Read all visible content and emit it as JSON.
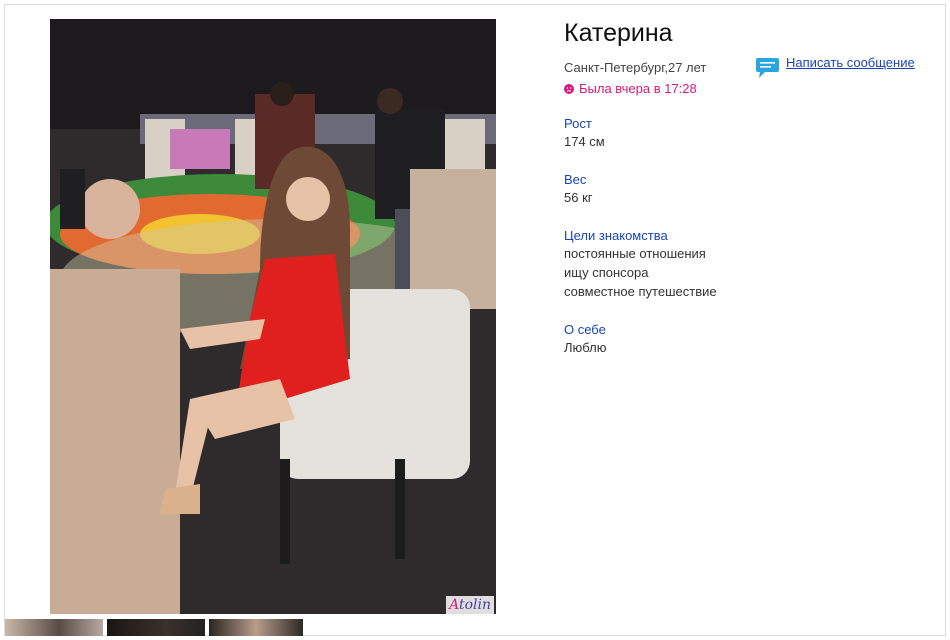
{
  "photo": {
    "watermark_prefix": "A",
    "watermark_rest": "tolin"
  },
  "profile": {
    "name": "Катерина",
    "location_age": "Санкт-Петербург,27 лет",
    "last_seen": "Была вчера в 17:28",
    "message_link": "Написать сообщение"
  },
  "details": [
    {
      "label": "Рост",
      "values": [
        "174 см"
      ]
    },
    {
      "label": "Вес",
      "values": [
        "56 кг"
      ]
    },
    {
      "label": "Цели знакомства",
      "values": [
        "постоянные отношения",
        "ищу спонсора",
        "совместное путешествие"
      ]
    },
    {
      "label": "О себе",
      "values": [
        "Люблю"
      ]
    }
  ],
  "colors": {
    "accent_link": "#1a44b8",
    "status_pink": "#d6187a",
    "message_icon": "#2aa6de"
  },
  "icons": {
    "status": "sad-face-icon",
    "message": "chat-bubble-icon"
  }
}
